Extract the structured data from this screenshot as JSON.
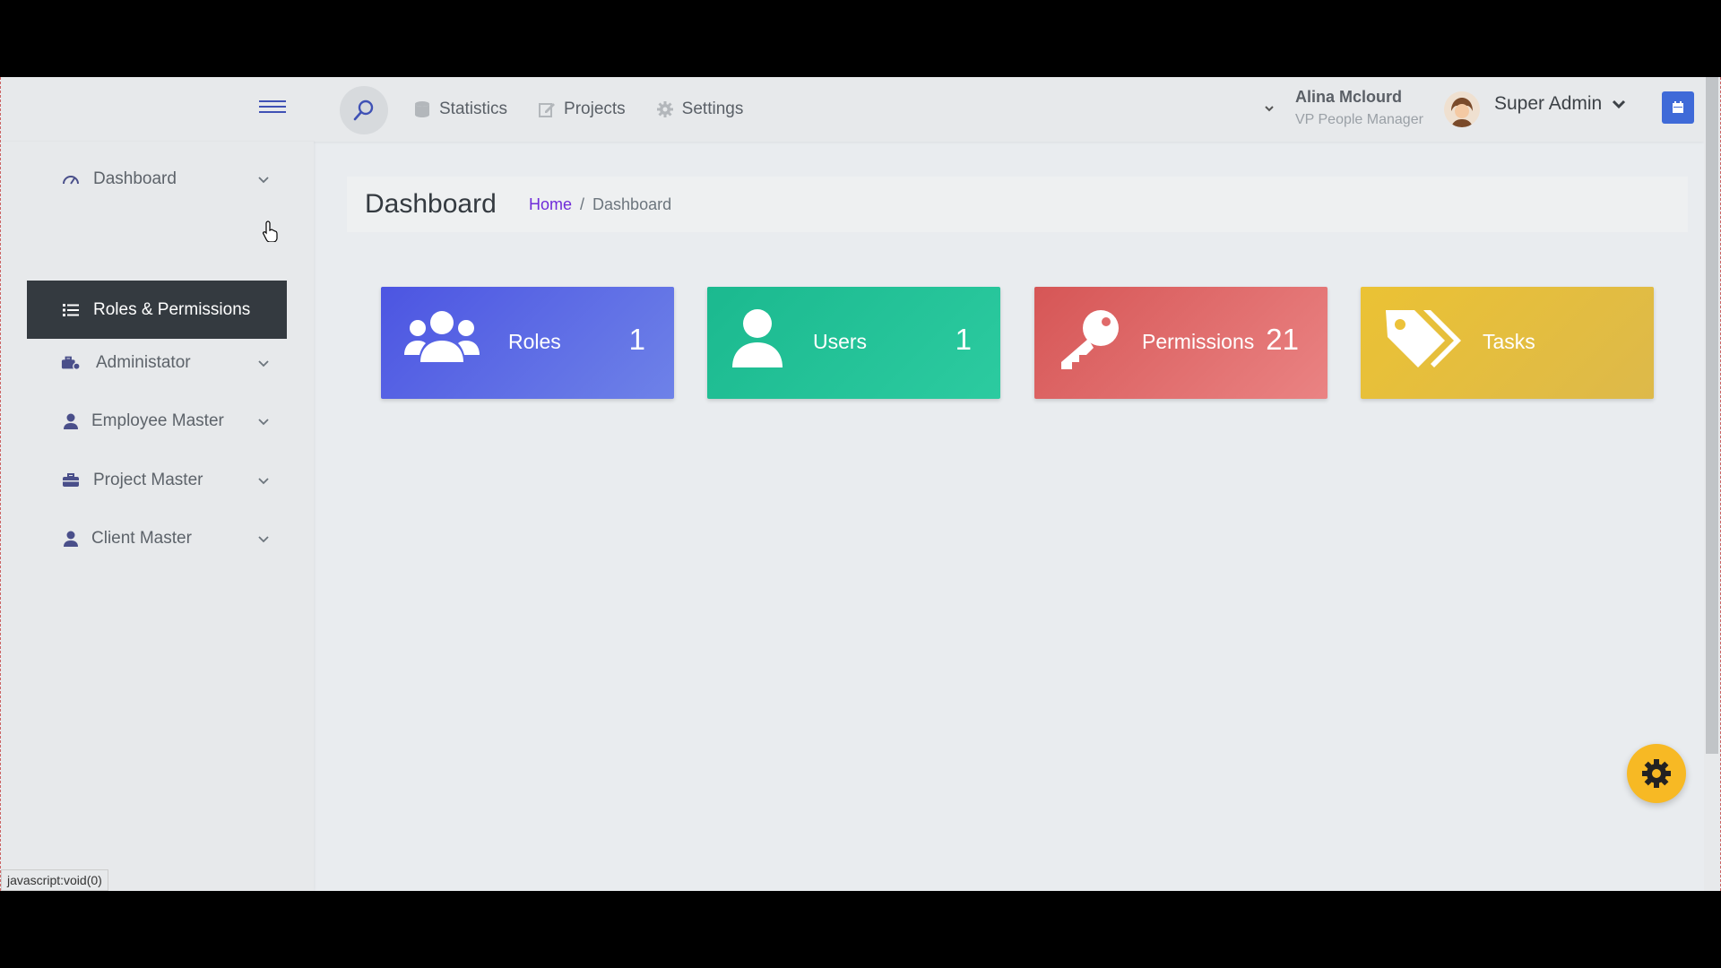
{
  "header": {
    "nav": [
      {
        "label": "Statistics",
        "icon": "database-icon"
      },
      {
        "label": "Projects",
        "icon": "edit-icon"
      },
      {
        "label": "Settings",
        "icon": "gear-icon"
      }
    ],
    "user": {
      "name": "Alina Mclourd",
      "role": "VP People Manager"
    },
    "admin_label": "Super Admin"
  },
  "sidebar": {
    "items": [
      {
        "label": "Dashboard",
        "icon": "dashboard-gauge-icon"
      },
      {
        "label": "Roles & Permissions",
        "icon": "list-check-icon",
        "active": true
      },
      {
        "label": "Administator",
        "icon": "user-cog-icon"
      },
      {
        "label": "Employee Master",
        "icon": "user-icon"
      },
      {
        "label": "Project Master",
        "icon": "briefcase-icon"
      },
      {
        "label": "Client Master",
        "icon": "user-icon"
      }
    ]
  },
  "page": {
    "title": "Dashboard",
    "breadcrumb": {
      "home": "Home",
      "sep": "/",
      "current": "Dashboard"
    }
  },
  "cards": [
    {
      "label": "Roles",
      "value": "1",
      "icon": "users-group-icon",
      "color": "#5a68e8"
    },
    {
      "label": "Users",
      "value": "1",
      "icon": "user-icon",
      "color": "#22c197"
    },
    {
      "label": "Permissions",
      "value": "21",
      "icon": "key-icon",
      "color": "#e06a6a"
    },
    {
      "label": "Tasks",
      "value": "",
      "icon": "tags-icon",
      "color": "#ecc23a"
    }
  ],
  "status_bar": "javascript:void(0)"
}
